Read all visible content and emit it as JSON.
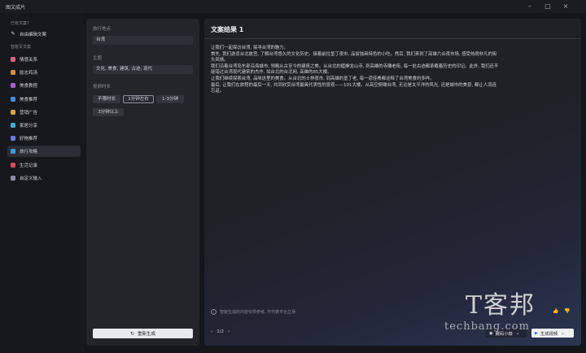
{
  "window": {
    "title": "图文成片"
  },
  "sidebar": {
    "section_existing": "已有文案?",
    "custom_item": "自由编辑文案",
    "section_smart": "智能写文案",
    "items": [
      {
        "label": "情感关系",
        "icon": "heart-icon",
        "color": "#e05a82"
      },
      {
        "label": "励志鸡汤",
        "icon": "flame-icon",
        "color": "#e08a3a"
      },
      {
        "label": "美食教程",
        "icon": "cup-icon",
        "color": "#b05ad8"
      },
      {
        "label": "美食推荐",
        "icon": "food-icon",
        "color": "#3a8fe0"
      },
      {
        "label": "营销广告",
        "icon": "megaphone-icon",
        "color": "#e0a23a"
      },
      {
        "label": "家居分享",
        "icon": "home-icon",
        "color": "#3ab0d8"
      },
      {
        "label": "好物推荐",
        "icon": "bag-icon",
        "color": "#6a7ae8"
      },
      {
        "label": "旅行攻略",
        "icon": "plane-icon",
        "color": "#3a9ae8"
      },
      {
        "label": "生活记录",
        "icon": "camera-icon",
        "color": "#d84a5a"
      },
      {
        "label": "自定义输入",
        "icon": "edit-icon",
        "color": "#8a8ca0"
      }
    ],
    "active_index": 7
  },
  "form": {
    "place_label": "旅行地点",
    "place_value": "台湾",
    "theme_label": "主题",
    "theme_value": "文化, 美食, 建筑, 古迹, 现代",
    "duration_label": "视频时长",
    "durations": [
      "不限时长",
      "1分钟左右",
      "1-3分钟",
      "3分钟以上"
    ],
    "selected_duration": 1,
    "regenerate_label": "重新生成"
  },
  "result": {
    "title": "文案结果 1",
    "paragraphs": [
      "让我们一起探访台湾, 探寻台湾的魅力。",
      "首先, 我们游览台北故宫, 了解台湾悠久的文化历史。接着前往垦丁夜市, 品尝独具特色的小吃。然后, 我们来到了高雄六合夜市场, 感受热闹非凡的街",
      "头风情。",
      "我们沿着台湾岛东部沿海城市, 领略从古至今的建筑之美。从台北的艋舺龙山寺, 到高雄的寺雕老街, 每一处古迹都承载着历史的印记。此外, 我们还不",
      "能错过台湾现代建筑的杰作, 如台北的台北网, 高雄的85大楼。",
      "让我们继续探索台湾, 品味这里的美食。从台北的士林夜市, 到高雄的垦丁老, 每一道佳肴都诠释了台湾美食的多样。",
      "最后, 让我们在旅程的最后一天, 共同欣赏台湾最具代表性的景观——101大楼。从高空俯瞰台湾, 无论是太平洋的风光, 还是城市的美景, 都让人流连",
      "忘返。"
    ],
    "notice": "智能生成的内容仅供参考, 不代表平台立场",
    "pager": "1/2",
    "voice_label": "戴码小薇",
    "generate_video_label": "生成视频"
  },
  "watermark": {
    "logo": "T客邦",
    "text": "techbang.com"
  }
}
